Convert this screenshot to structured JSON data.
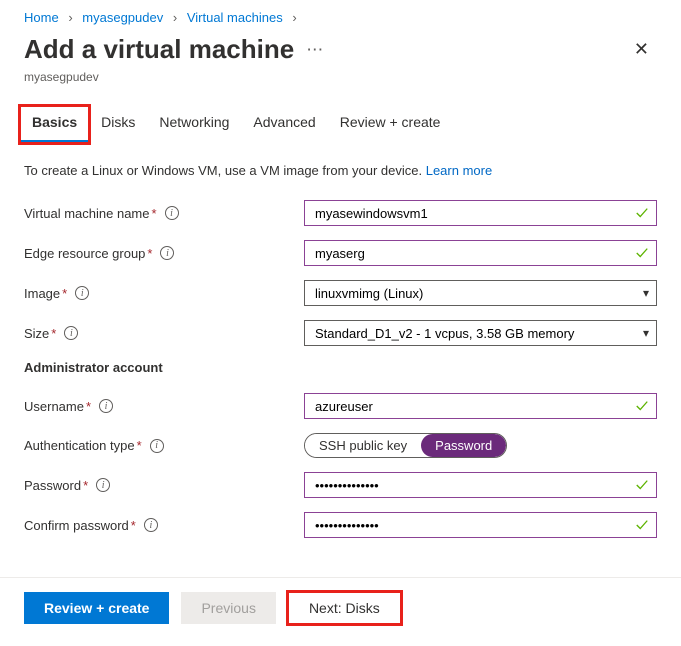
{
  "breadcrumb": [
    {
      "label": "Home"
    },
    {
      "label": "myasegpudev"
    },
    {
      "label": "Virtual machines"
    }
  ],
  "header": {
    "title": "Add a virtual machine",
    "subtitle": "myasegpudev"
  },
  "tabs": [
    {
      "label": "Basics",
      "active": true
    },
    {
      "label": "Disks"
    },
    {
      "label": "Networking"
    },
    {
      "label": "Advanced"
    },
    {
      "label": "Review + create"
    }
  ],
  "helptext": {
    "prefix": "To create a Linux or Windows VM, use a VM image from your device. ",
    "link": "Learn more"
  },
  "fields": {
    "vm_name": {
      "label": "Virtual machine name",
      "value": "myasewindowsvm1"
    },
    "erg": {
      "label": "Edge resource group",
      "value": "myaserg"
    },
    "image": {
      "label": "Image",
      "value": "linuxvmimg (Linux)"
    },
    "size": {
      "label": "Size",
      "value": "Standard_D1_v2 - 1 vcpus, 3.58 GB memory"
    },
    "admin_header": "Administrator account",
    "username": {
      "label": "Username",
      "value": "azureuser"
    },
    "auth_type": {
      "label": "Authentication type",
      "opt_ssh": "SSH public key",
      "opt_pwd": "Password"
    },
    "password": {
      "label": "Password",
      "value": "••••••••••••••"
    },
    "confirm": {
      "label": "Confirm password",
      "value": "••••••••••••••"
    }
  },
  "footer": {
    "review": "Review + create",
    "previous": "Previous",
    "next": "Next: Disks"
  }
}
